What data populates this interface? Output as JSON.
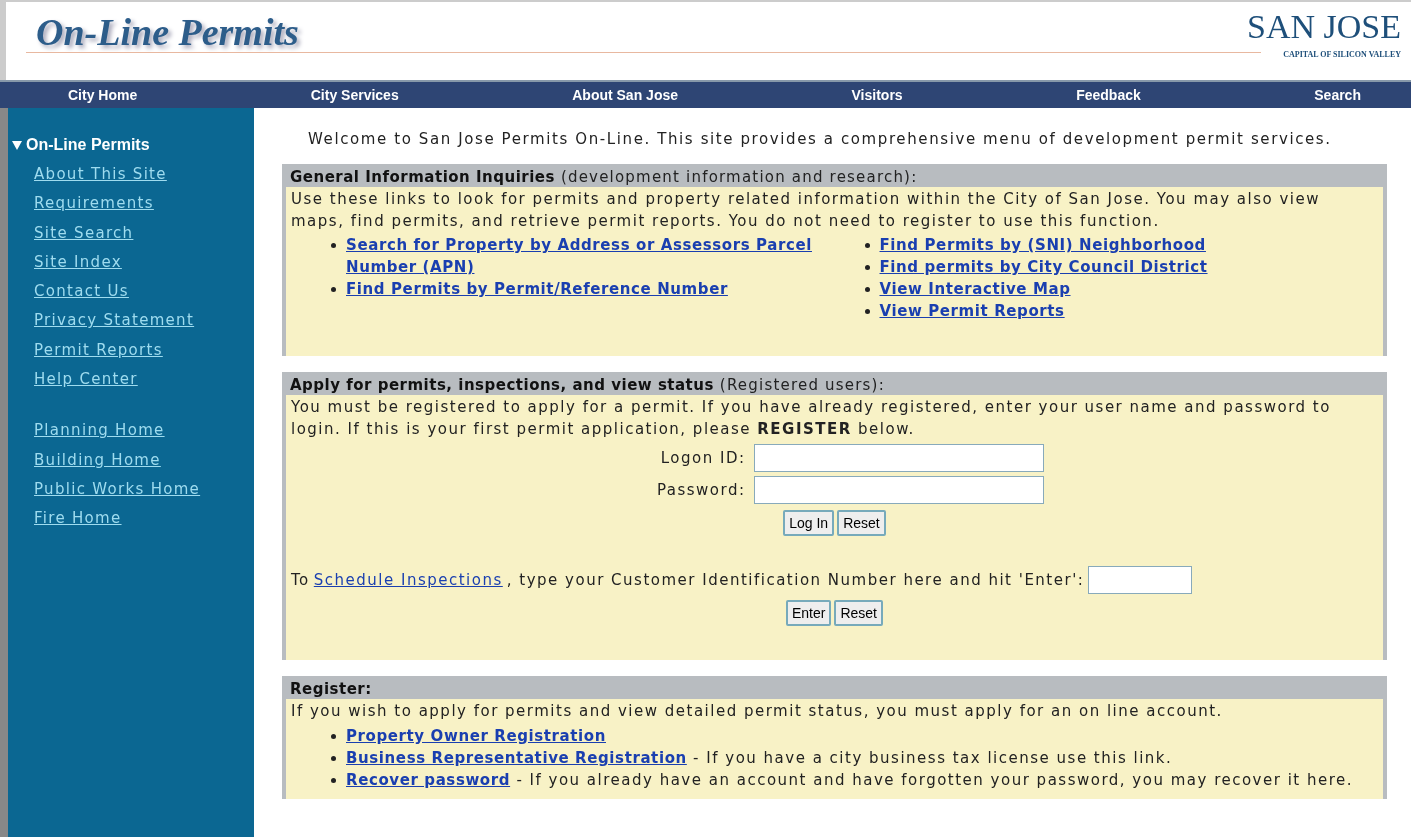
{
  "header": {
    "title": "On-Line Permits",
    "logo_name": "SAN JOSE",
    "logo_tagline": "CAPITAL OF SILICON VALLEY"
  },
  "nav": [
    "City Home",
    "City Services",
    "About San Jose",
    "Visitors",
    "Feedback",
    "Search"
  ],
  "sidebar": {
    "heading": "On-Line Permits",
    "expanded": true,
    "groups": [
      [
        "About This Site",
        "Requirements",
        "Site Search",
        "Site Index",
        "Contact Us",
        "Privacy Statement",
        "Permit Reports",
        "Help Center"
      ],
      [
        "Planning Home",
        "Building Home",
        "Public Works Home",
        "Fire Home"
      ]
    ]
  },
  "intro": "Welcome to San Jose Permits On-Line. This site provides a comprehensive menu of development permit services.",
  "sections": [
    {
      "kind": "links",
      "heading": "General Information Inquiries",
      "note": "(development information and research):",
      "text": "Use these links to look for permits and property related information within the City of San Jose. You may also view maps, find permits, and retrieve permit reports. You do not need to register to use this function.",
      "columns": [
        [
          "Search for Property by Address or Assessors Parcel Number (APN)",
          "Find Permits by Permit/Reference Number"
        ],
        [
          "Find Permits by (SNI) Neighborhood",
          "Find permits by City Council District",
          "View Interactive Map",
          "View Permit Reports"
        ]
      ]
    },
    {
      "kind": "login",
      "heading": "Apply for permits, inspections, and view status",
      "note": "(Registered users):",
      "text": "You must be registered to apply for a permit. If you have already registered, enter your user name and password to login. If this is your first permit application, please **REGISTER** below.",
      "fields": [
        {
          "label": "Logon ID:"
        },
        {
          "label": "Password:"
        }
      ],
      "buttons": [
        "Log In",
        "Reset"
      ],
      "schedule": {
        "prefix": "To",
        "link": "Schedule Inspections",
        "suffix": ", type your Customer Identification Number here and hit 'Enter':"
      },
      "schedule_buttons": [
        "Enter",
        "Reset"
      ]
    },
    {
      "kind": "register",
      "heading": "Register:",
      "text": "If you wish to apply for permits and view detailed permit status, you must apply for an on line account.",
      "items": [
        {
          "link": "Property Owner Registration"
        },
        {
          "link": "Business Representative Registration",
          "note": "- If you have a city business tax license use this link."
        },
        {
          "link": "Recover password",
          "note": "- If you already have an account and have forgotten your password, you may recover it here."
        }
      ]
    }
  ]
}
